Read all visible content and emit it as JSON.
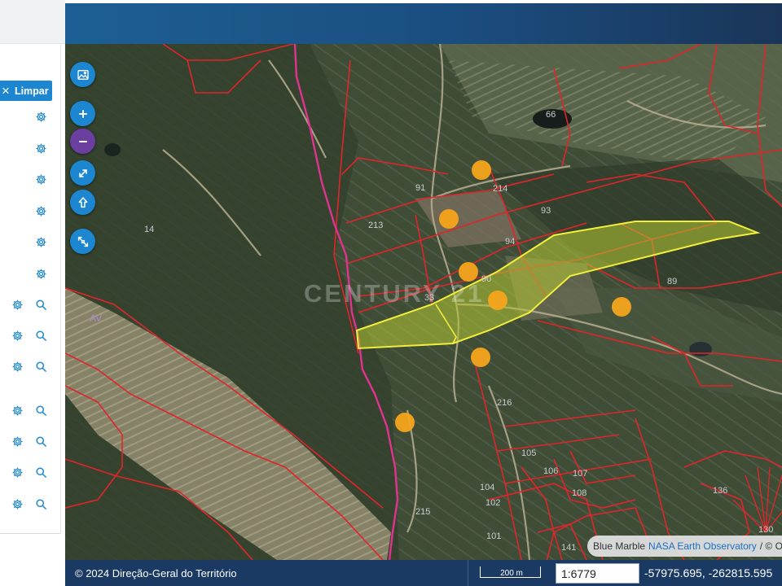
{
  "sidebar": {
    "clear_label": "Limpar",
    "layers": [
      {
        "settings_icon": "gear-icon"
      },
      {
        "settings_icon": "gear-icon"
      },
      {
        "settings_icon": "gear-icon"
      },
      {
        "settings_icon": "gear-icon"
      },
      {
        "settings_icon": "gear-icon"
      },
      {
        "settings_icon": "gear-icon"
      },
      {
        "settings_icon": "gear-icon",
        "zoom_icon": "search-icon"
      },
      {
        "settings_icon": "gear-icon",
        "zoom_icon": "search-icon"
      },
      {
        "settings_icon": "gear-icon",
        "zoom_icon": "search-icon"
      },
      {
        "settings_icon": "gear-icon",
        "zoom_icon": "search-icon"
      },
      {
        "settings_icon": "gear-icon",
        "zoom_icon": "search-icon"
      },
      {
        "settings_icon": "gear-icon",
        "zoom_icon": "search-icon"
      },
      {
        "settings_icon": "gear-icon",
        "zoom_icon": "search-icon"
      }
    ]
  },
  "map_controls": [
    {
      "name": "basemap-button",
      "icon": "image-icon"
    },
    {
      "name": "zoom-in-button",
      "icon": "plus-icon"
    },
    {
      "name": "zoom-out-button",
      "icon": "minus-icon"
    },
    {
      "name": "fullscreen-button",
      "icon": "expand-arrows-icon"
    },
    {
      "name": "north-up-button",
      "icon": "arrow-up-icon"
    },
    {
      "name": "zoom-extent-button",
      "icon": "zoom-extent-icon"
    }
  ],
  "map": {
    "watermark": "CENTURY 21",
    "area_label": "AV",
    "parcel_labels": [
      {
        "text": "14"
      },
      {
        "text": "91"
      },
      {
        "text": "214"
      },
      {
        "text": "213"
      },
      {
        "text": "93"
      },
      {
        "text": "94"
      },
      {
        "text": "90"
      },
      {
        "text": "89"
      },
      {
        "text": "33"
      },
      {
        "text": "216"
      },
      {
        "text": "105"
      },
      {
        "text": "106"
      },
      {
        "text": "107"
      },
      {
        "text": "108"
      },
      {
        "text": "104"
      },
      {
        "text": "102"
      },
      {
        "text": "101"
      },
      {
        "text": "215"
      },
      {
        "text": "136"
      },
      {
        "text": "141"
      },
      {
        "text": "66"
      },
      {
        "text": "130"
      }
    ],
    "colors": {
      "parcel_border": "#e0252b",
      "road": "#e0338e",
      "selection_fill": "#b7c933",
      "selection_stroke": "#f2ee3c",
      "marker": "#f6a51c"
    }
  },
  "attribution": {
    "prefix": "Blue Marble",
    "link": "NASA Earth Observatory",
    "suffix": "/ © Or"
  },
  "footer": {
    "copyright": "© 2024 Direção-Geral do Território",
    "scale_bar_label": "200 m",
    "scale": "1:6779",
    "coordinates": "-57975.695, -262815.595"
  }
}
